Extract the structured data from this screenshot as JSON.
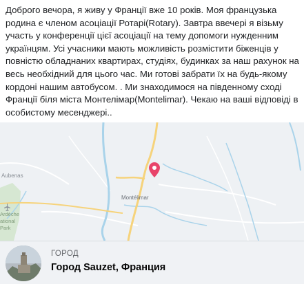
{
  "post": {
    "text": "Доброго вечора, я живу у Франції вже 10 років. Моя французька родина є членом асоціації Ротарі(Rotary). Завтра ввечері я візьму участь у конференції цієї асоціації на тему допомоги нужденним українцям. Усі учасники мають можливість розмістити біженців у повністю обладнаних квартирах, студіях, будинках за наш рахунок на весь необхідний для цього час. Ми готові забрати їх на будь-якому кордоні нашим автобусом. . Ми знаходимося на південному сході Франції біля міста Монтелімар(Montelimar). Чекаю на ваші відповіді в особистому месенджері.."
  },
  "map": {
    "labels": {
      "aubenas": "Aubenas",
      "montelimar": "Montélimar",
      "ardeche_1": "Ardèche",
      "ardeche_2": "ational",
      "ardeche_3": "Park"
    },
    "colors": {
      "background": "#eef1f4",
      "river": "#a9d3ea",
      "road_main": "#f6d37b",
      "road_minor": "#ffffff",
      "park": "#cfe5c9",
      "pin": "#e8446a"
    }
  },
  "location": {
    "kicker": "ГОРОД",
    "name": "Город Sauzet, Франция"
  }
}
